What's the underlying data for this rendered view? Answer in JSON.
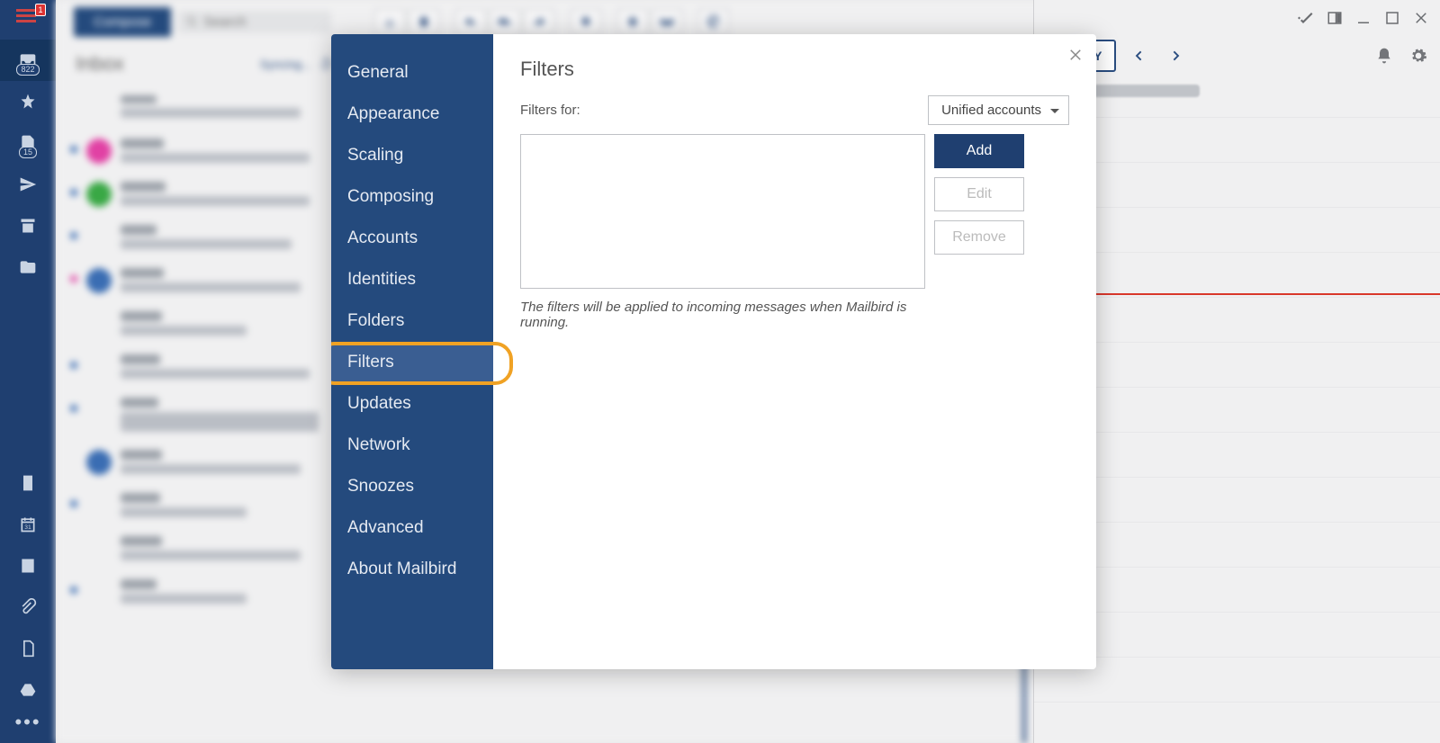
{
  "appbar": {
    "menu_badge": "1",
    "inbox_count": "822",
    "drafts_count": "15"
  },
  "toolbar": {
    "compose_label": "Compose",
    "search_placeholder": "Search"
  },
  "inbox": {
    "title": "Inbox",
    "syncing": "Syncing..."
  },
  "calendar": {
    "today_label": "TODAY"
  },
  "dialog": {
    "nav": {
      "general": "General",
      "appearance": "Appearance",
      "scaling": "Scaling",
      "composing": "Composing",
      "accounts": "Accounts",
      "identities": "Identities",
      "folders": "Folders",
      "filters": "Filters",
      "updates": "Updates",
      "network": "Network",
      "snoozes": "Snoozes",
      "advanced": "Advanced",
      "about": "About Mailbird"
    },
    "content": {
      "title": "Filters",
      "filters_for_label": "Filters for:",
      "account_selected": "Unified accounts",
      "add_label": "Add",
      "edit_label": "Edit",
      "remove_label": "Remove",
      "note": "The filters will be applied to incoming messages when Mailbird is running."
    }
  }
}
